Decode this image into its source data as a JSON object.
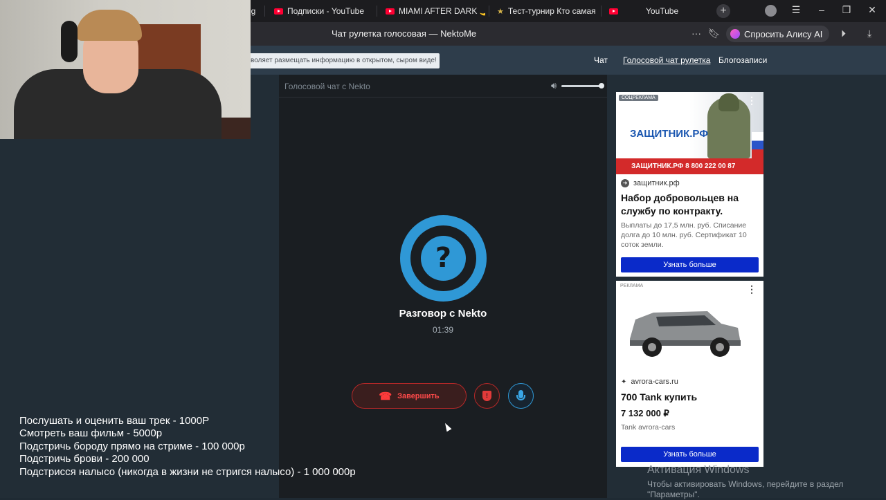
{
  "browser": {
    "tabs": [
      {
        "label": "ng",
        "icon": "none"
      },
      {
        "label": "Подписки - YouTube",
        "icon": "youtube-icon"
      },
      {
        "label": "MIAMI AFTER DARK 🌙 S",
        "icon": "youtube-icon"
      },
      {
        "label": "Тест-турнир Кто самая к",
        "icon": "star-icon"
      },
      {
        "label": "YouTube",
        "icon": "youtube-icon"
      }
    ],
    "new_tab": "+",
    "page_title": "Чат рулетка голосовая — NektoMe",
    "alice_label": "Спросить Алису AI"
  },
  "site": {
    "notice": "воляет размещать информацию в открытом, сыром виде!",
    "nav": [
      "Чат",
      "Голосовой чат рулетка",
      "Блогозаписи"
    ]
  },
  "voice_chat": {
    "panel_title": "Голосовой чат с Nekto",
    "avatar_glyph": "?",
    "conversation_title": "Разговор с Nekto",
    "timer": "01:39",
    "end_button": "Завершить",
    "volume_level": 1.0,
    "accent_color": "#2f98d6",
    "danger_color": "#e33a3a"
  },
  "ads": [
    {
      "label": "СОЦРЕКЛАМА",
      "banner_brand": "ЗАЩИТНИК.РФ",
      "banner_strip": "ЗАЩИТНИК.РФ  8 800 222 00 87",
      "domain": "защитник.рф",
      "headline": "Набор добровольцев на службу по контракту.",
      "body": "Выплаты до 17,5 млн. руб. Списание долга до 10 млн. руб. Сертификат 10 соток земли.",
      "button": "Узнать больше"
    },
    {
      "label": "РЕКЛАМА",
      "domain": "avrora-cars.ru",
      "headline": "700 Tank купить",
      "price": "7 132 000 ₽",
      "body": "Tank avrora-cars",
      "button": "Узнать больше"
    }
  ],
  "overlay": {
    "price_list": [
      "Послушать и оценить ваш трек - 1000Р",
      "Смотреть ваш фильм - 5000р",
      "Подстричь бороду прямо на стриме - 100 000р",
      "Подстричь брови - 200 000",
      "Подстрисся налысо (никогда в жизни не стригся налысо) - 1 000 000р"
    ]
  },
  "windows_activation": {
    "title": "Активация Windows",
    "body": "Чтобы активировать Windows, перейдите в раздел \"Параметры\"."
  }
}
